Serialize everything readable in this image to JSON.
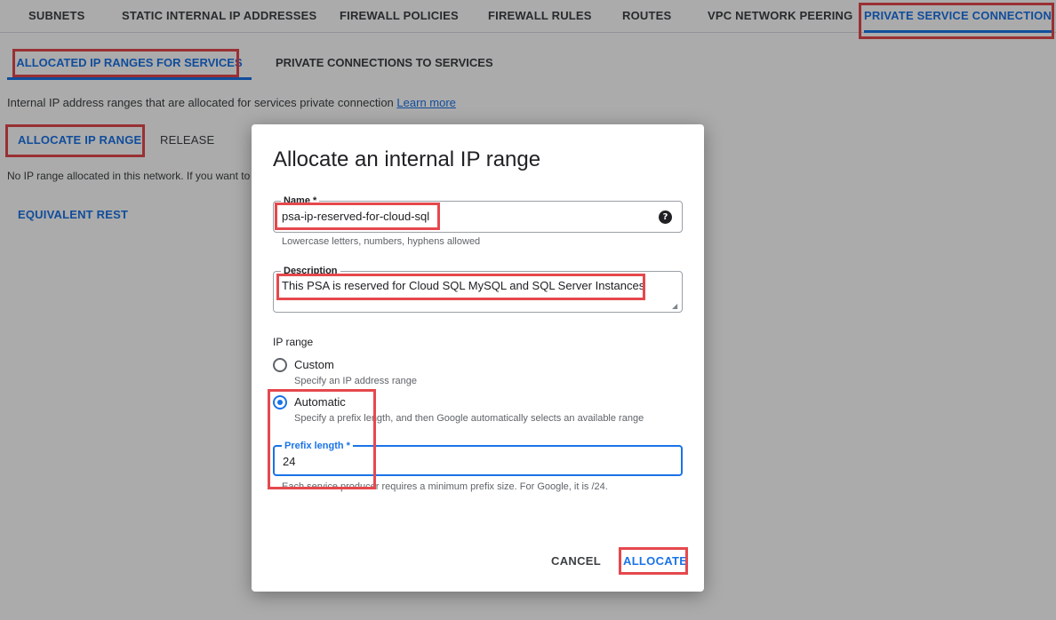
{
  "top_tabs": [
    {
      "label": "SUBNETS"
    },
    {
      "label": "STATIC INTERNAL IP ADDRESSES"
    },
    {
      "label": "FIREWALL POLICIES"
    },
    {
      "label": "FIREWALL RULES"
    },
    {
      "label": "ROUTES"
    },
    {
      "label": "VPC NETWORK PEERING"
    },
    {
      "label": "PRIVATE SERVICE CONNECTION",
      "active": true
    }
  ],
  "sub_tabs": [
    {
      "label": "ALLOCATED IP RANGES FOR SERVICES",
      "active": true
    },
    {
      "label": "PRIVATE CONNECTIONS TO SERVICES"
    }
  ],
  "info": {
    "text": "Internal IP address ranges that are allocated for services private connection",
    "link": "Learn more"
  },
  "actions": {
    "allocate_label": "ALLOCATE IP RANGE",
    "release_label": "RELEASE"
  },
  "empty_text": "No IP range allocated in this network. If you want to",
  "equivalent_rest": "EQUIVALENT REST",
  "dialog": {
    "title": "Allocate an internal IP range",
    "name": {
      "label": "Name *",
      "value": "psa-ip-reserved-for-cloud-sql",
      "hint": "Lowercase letters, numbers, hyphens allowed",
      "help_icon": "help-circle-icon"
    },
    "description": {
      "label": "Description",
      "value": "This PSA is reserved for Cloud SQL MySQL and SQL Server Instances"
    },
    "ip_range": {
      "label": "IP range",
      "options": [
        {
          "label": "Custom",
          "desc": "Specify an IP address range",
          "checked": false
        },
        {
          "label": "Automatic",
          "desc": "Specify a prefix length, and then Google automatically selects an available range",
          "checked": true
        }
      ]
    },
    "prefix": {
      "label": "Prefix length *",
      "value": "24",
      "hint": "Each service producer requires a minimum prefix size. For Google, it is /24."
    },
    "cancel_label": "CANCEL",
    "allocate_label": "ALLOCATE"
  },
  "colors": {
    "accent": "#1a73e8",
    "highlight": "#e5484d"
  }
}
